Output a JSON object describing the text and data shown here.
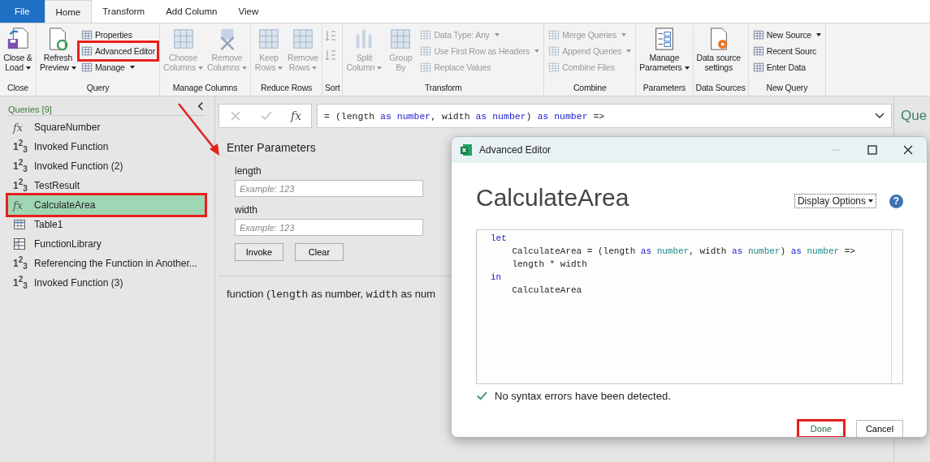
{
  "ribbon": {
    "tabs": [
      {
        "label": "File",
        "kind": "file",
        "selected": false
      },
      {
        "label": "Home",
        "kind": "tab",
        "selected": true
      },
      {
        "label": "Transform",
        "kind": "tab",
        "selected": false
      },
      {
        "label": "Add Column",
        "kind": "tab",
        "selected": false
      },
      {
        "label": "View",
        "kind": "tab",
        "selected": false
      }
    ],
    "groups": [
      {
        "label": "Close",
        "items": [
          {
            "kind": "large",
            "lines": [
              "Close &",
              "Load"
            ],
            "dropdown": true,
            "disabled": false,
            "highlighted": false
          }
        ]
      },
      {
        "label": "Query",
        "items": [
          {
            "kind": "large",
            "lines": [
              "Refresh",
              "Preview"
            ],
            "dropdown": true,
            "disabled": false,
            "highlighted": false
          },
          {
            "kind": "small",
            "label": "Properties",
            "dropdown": false,
            "disabled": false,
            "highlighted": false
          },
          {
            "kind": "small",
            "label": "Advanced Editor",
            "dropdown": false,
            "disabled": false,
            "highlighted": true
          },
          {
            "kind": "small",
            "label": "Manage",
            "dropdown": true,
            "disabled": false,
            "highlighted": false
          }
        ]
      },
      {
        "label": "Manage Columns",
        "items": [
          {
            "kind": "large",
            "lines": [
              "Choose",
              "Columns"
            ],
            "dropdown": true,
            "disabled": true,
            "highlighted": false
          },
          {
            "kind": "large",
            "lines": [
              "Remove",
              "Columns"
            ],
            "dropdown": true,
            "disabled": true,
            "highlighted": false
          }
        ]
      },
      {
        "label": "Reduce Rows",
        "items": [
          {
            "kind": "large",
            "lines": [
              "Keep",
              "Rows"
            ],
            "dropdown": true,
            "disabled": true,
            "highlighted": false
          },
          {
            "kind": "large",
            "lines": [
              "Remove",
              "Rows"
            ],
            "dropdown": true,
            "disabled": true,
            "highlighted": false
          }
        ]
      },
      {
        "label": "Sort",
        "items": [
          {
            "kind": "sort",
            "disabled": true
          }
        ]
      },
      {
        "label": "Transform",
        "items": [
          {
            "kind": "large",
            "lines": [
              "Split",
              "Column"
            ],
            "dropdown": true,
            "disabled": true,
            "highlighted": false
          },
          {
            "kind": "large",
            "lines": [
              "Group",
              "By"
            ],
            "dropdown": false,
            "disabled": true,
            "highlighted": false
          },
          {
            "kind": "small",
            "label": "Data Type: Any",
            "dropdown": true,
            "disabled": true,
            "highlighted": false
          },
          {
            "kind": "small",
            "label": "Use First Row as Headers",
            "dropdown": true,
            "disabled": true,
            "highlighted": false
          },
          {
            "kind": "small",
            "label": "Replace Values",
            "dropdown": false,
            "disabled": true,
            "highlighted": false
          }
        ]
      },
      {
        "label": "Combine",
        "items": [
          {
            "kind": "small",
            "label": "Merge Queries",
            "dropdown": true,
            "disabled": true,
            "highlighted": false
          },
          {
            "kind": "small",
            "label": "Append Queries",
            "dropdown": true,
            "disabled": true,
            "highlighted": false
          },
          {
            "kind": "small",
            "label": "Combine Files",
            "dropdown": false,
            "disabled": true,
            "highlighted": false
          }
        ]
      },
      {
        "label": "Parameters",
        "items": [
          {
            "kind": "large",
            "lines": [
              "Manage",
              "Parameters"
            ],
            "dropdown": true,
            "disabled": false,
            "highlighted": false
          }
        ]
      },
      {
        "label": "Data Sources",
        "items": [
          {
            "kind": "large",
            "lines": [
              "Data source",
              "settings"
            ],
            "dropdown": false,
            "disabled": false,
            "highlighted": false
          }
        ]
      },
      {
        "label": "New Query",
        "items": [
          {
            "kind": "small",
            "label": "New Source",
            "dropdown": true,
            "disabled": false,
            "highlighted": false
          },
          {
            "kind": "small",
            "label": "Recent Sourc",
            "dropdown": false,
            "disabled": false,
            "highlighted": false
          },
          {
            "kind": "small",
            "label": "Enter Data",
            "dropdown": false,
            "disabled": false,
            "highlighted": false
          }
        ]
      }
    ]
  },
  "queries": {
    "title": "Queries [9]",
    "items": [
      {
        "label": "SquareNumber",
        "kind": "function",
        "symbol": "fx",
        "selected": false,
        "highlighted": false
      },
      {
        "label": "Invoked Function",
        "kind": "value",
        "symbol": "1$^{2}$$_{3}$",
        "selected": false,
        "highlighted": false
      },
      {
        "label": "Invoked Function (2)",
        "kind": "value",
        "symbol": "1$^{2}$$_{3}$",
        "selected": false,
        "highlighted": false
      },
      {
        "label": "TestResult",
        "kind": "value",
        "symbol": "1$^{2}$$_{3}$",
        "selected": false,
        "highlighted": false
      },
      {
        "label": "CalculateArea",
        "kind": "function",
        "symbol": "fx",
        "selected": true,
        "highlighted": true
      },
      {
        "label": "Table1",
        "kind": "table",
        "selected": false,
        "highlighted": false
      },
      {
        "label": "FunctionLibrary",
        "kind": "library",
        "selected": false,
        "highlighted": false
      },
      {
        "label": "Referencing the Function in Another...",
        "kind": "value",
        "symbol": "1$^{2}$$_{3}$",
        "selected": false,
        "highlighted": false
      },
      {
        "label": "Invoked Function (3)",
        "kind": "value",
        "symbol": "1$^{2}$$_{3}$",
        "selected": false,
        "highlighted": false
      }
    ]
  },
  "formula_bar": {
    "fx": "fx",
    "tokens": [
      {
        "text": "= (length ",
        "kind": "plain"
      },
      {
        "text": "as ",
        "kind": "keyword"
      },
      {
        "text": "number",
        "kind": "type"
      },
      {
        "text": ", width ",
        "kind": "plain"
      },
      {
        "text": "as ",
        "kind": "keyword"
      },
      {
        "text": "number",
        "kind": "type"
      },
      {
        "text": ") ",
        "kind": "plain"
      },
      {
        "text": "as ",
        "kind": "keyword"
      },
      {
        "text": "number",
        "kind": "type"
      },
      {
        "text": " =>",
        "kind": "plain"
      }
    ]
  },
  "parameters": {
    "title": "Enter Parameters",
    "fields": [
      {
        "label": "length",
        "placeholder": "Example: 123"
      },
      {
        "label": "width",
        "placeholder": "Example: 123"
      }
    ],
    "buttons": [
      "Invoke",
      "Clear"
    ],
    "signature": [
      {
        "text": "function (",
        "kind": "plain"
      },
      {
        "text": "length",
        "kind": "code"
      },
      {
        "text": " as number, ",
        "kind": "plain"
      },
      {
        "text": "width",
        "kind": "code"
      },
      {
        "text": " as num",
        "kind": "plain"
      }
    ]
  },
  "query_settings": {
    "title": "Que"
  },
  "dialog": {
    "title": "Advanced Editor",
    "heading": "CalculateArea",
    "display_options": "Display Options",
    "help": "?",
    "code": [
      [
        {
          "text": "let",
          "kind": "keyword"
        }
      ],
      [
        {
          "text": "    CalculateArea = (length ",
          "kind": "plain"
        },
        {
          "text": "as ",
          "kind": "keyword"
        },
        {
          "text": "number",
          "kind": "type"
        },
        {
          "text": ", width ",
          "kind": "plain"
        },
        {
          "text": "as ",
          "kind": "keyword"
        },
        {
          "text": "number",
          "kind": "type"
        },
        {
          "text": ") ",
          "kind": "plain"
        },
        {
          "text": "as ",
          "kind": "keyword"
        },
        {
          "text": "number",
          "kind": "type"
        },
        {
          "text": " =>",
          "kind": "plain"
        }
      ],
      [
        {
          "text": "    length * width",
          "kind": "plain"
        }
      ],
      [
        {
          "text": "in",
          "kind": "keyword"
        }
      ],
      [
        {
          "text": "    CalculateArea",
          "kind": "plain"
        }
      ]
    ],
    "status": "No syntax errors have been detected.",
    "buttons": [
      {
        "label": "Done",
        "highlighted": true
      },
      {
        "label": "Cancel",
        "highlighted": false
      }
    ]
  }
}
